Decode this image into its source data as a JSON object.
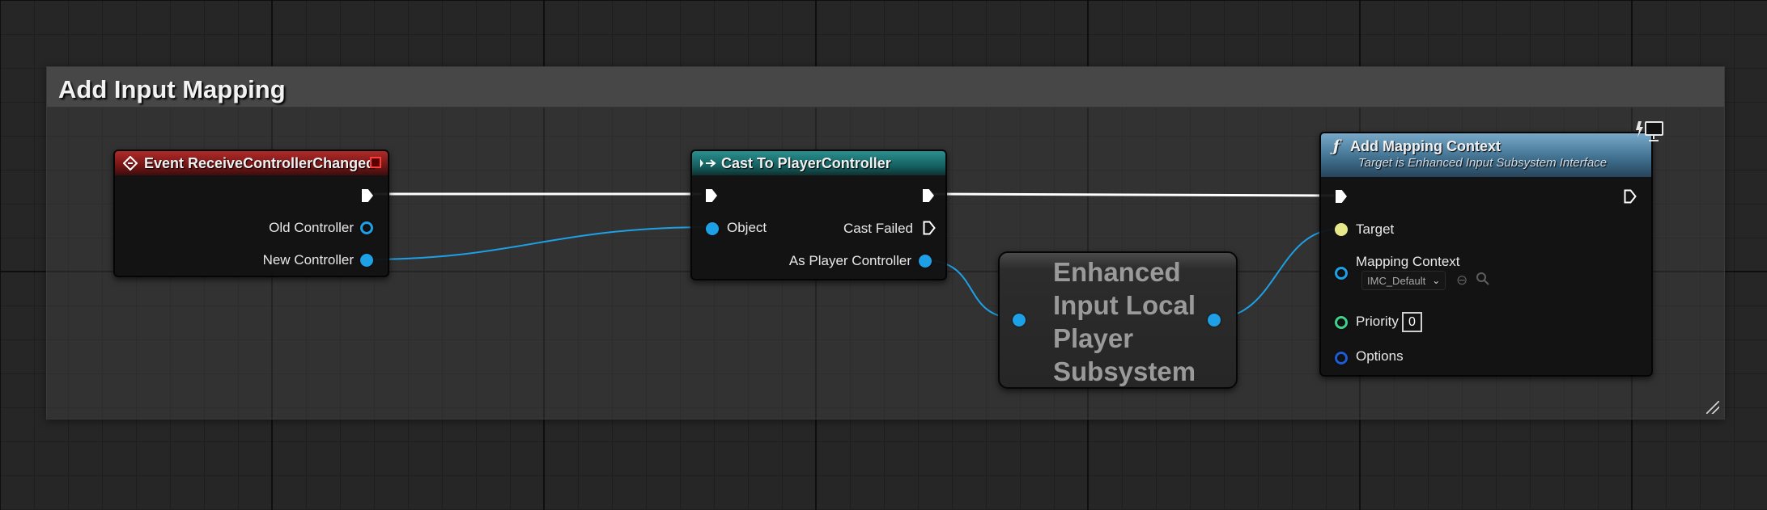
{
  "comment": {
    "title": "Add Input Mapping"
  },
  "event_node": {
    "title": "Event ReceiveControllerChanged",
    "pins": {
      "old_controller": "Old Controller",
      "new_controller": "New Controller"
    }
  },
  "cast_node": {
    "title": "Cast To PlayerController",
    "pins": {
      "object": "Object",
      "cast_failed": "Cast Failed",
      "as_player_controller": "As Player Controller"
    }
  },
  "subsystem_node": {
    "title_lines": [
      "Enhanced",
      "Input Local",
      "Player",
      "Subsystem"
    ]
  },
  "add_mapping_node": {
    "title": "Add Mapping Context",
    "subtitle": "Target is Enhanced Input Subsystem Interface",
    "pins": {
      "target": "Target",
      "mapping_context": "Mapping Context",
      "mapping_context_value": "IMC_Default",
      "priority": "Priority",
      "priority_value": "0",
      "options": "Options"
    }
  },
  "icons": {
    "event_node": "event-diamond-icon",
    "cast_node": "cast-icon",
    "add_mapping_node": "function-icon",
    "net_mode": "client-monitor-icon",
    "asset_reset": "reset-arrow-icon",
    "asset_browse": "magnifier-icon"
  },
  "colors": {
    "exec_wire": "#ffffff",
    "object_wire": "#1ea0e6",
    "event_header": "#9a1f1f",
    "cast_header": "#1d7575",
    "function_header": "#5a8aa8",
    "target_pin": "#e6e88a",
    "priority_pin": "#3fd18c",
    "options_pin": "#1e5bd6"
  }
}
